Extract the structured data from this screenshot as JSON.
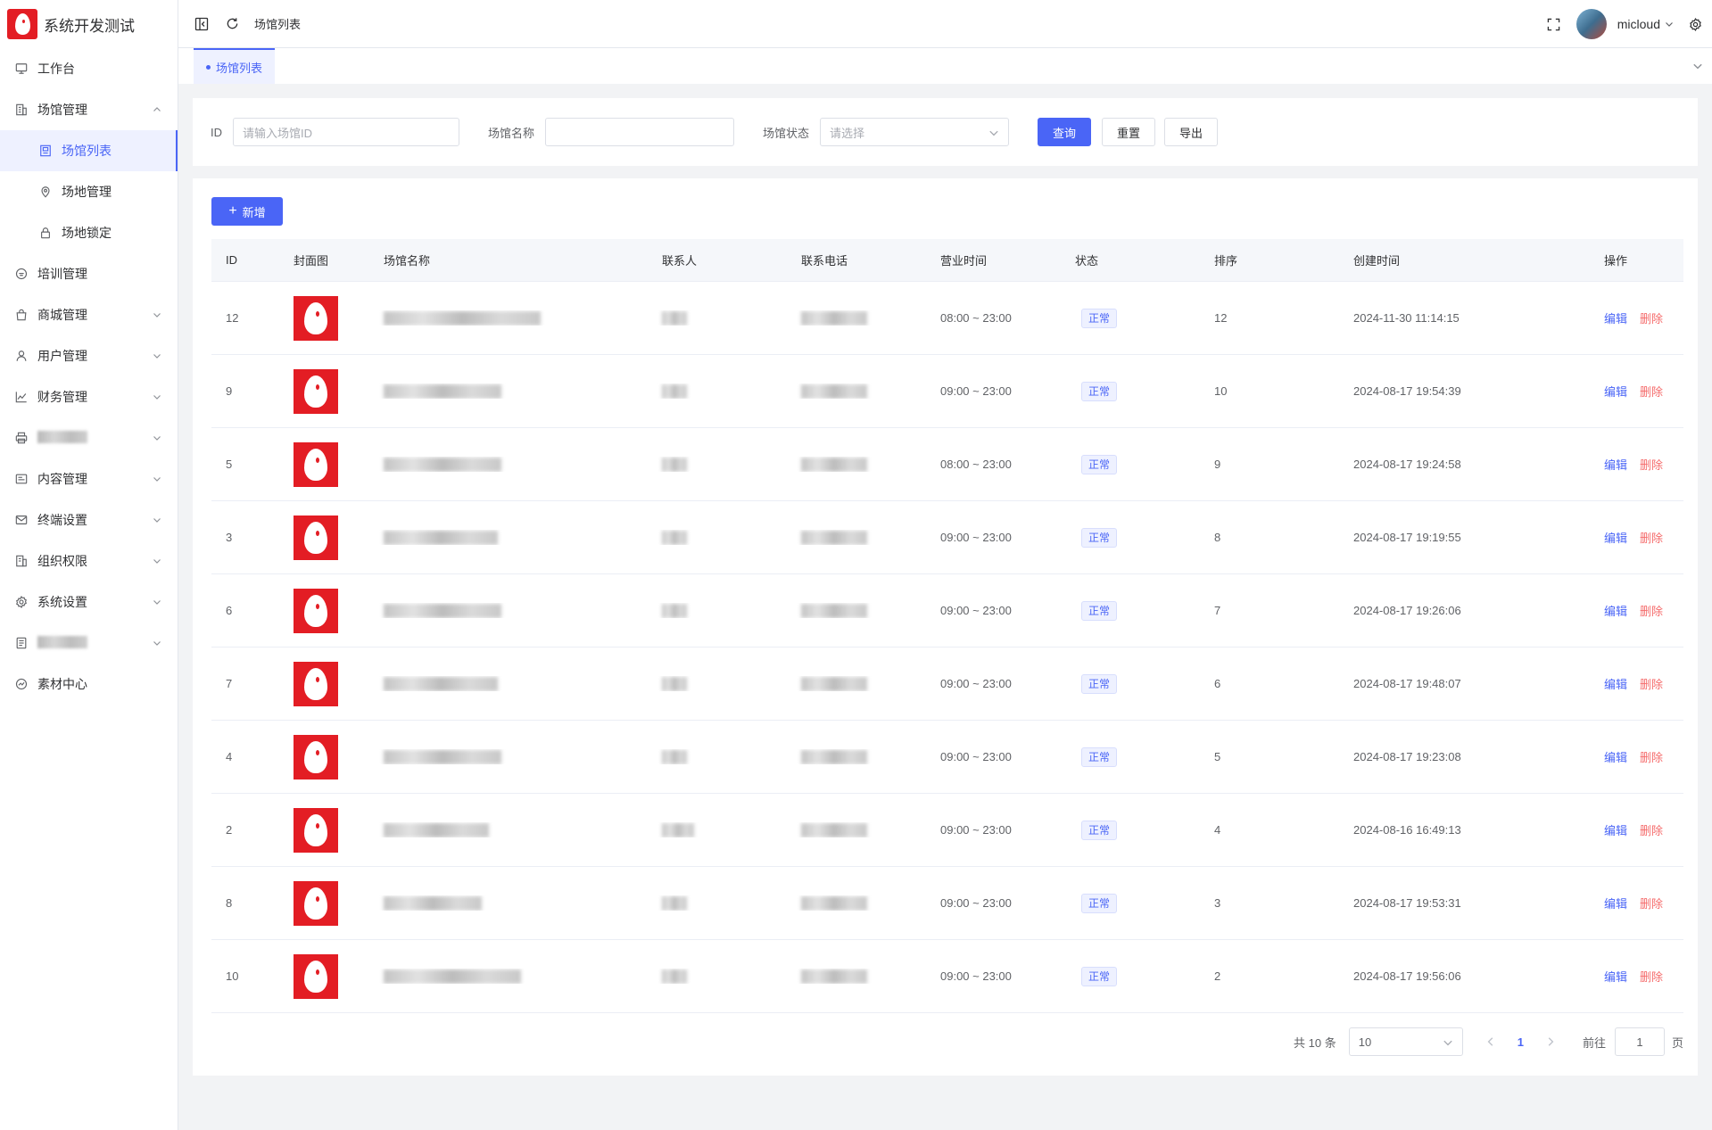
{
  "app": {
    "title": "系统开发测试"
  },
  "sidebar": {
    "items": [
      {
        "label": "工作台",
        "icon": "monitor-icon",
        "expandable": false
      },
      {
        "label": "场馆管理",
        "icon": "building-icon",
        "expandable": true,
        "expanded": true
      },
      {
        "label": "场馆列表",
        "icon": "venue-list-icon",
        "sub": true,
        "active": true
      },
      {
        "label": "场地管理",
        "icon": "location-icon",
        "sub": true
      },
      {
        "label": "场地锁定",
        "icon": "lock-icon",
        "sub": true
      },
      {
        "label": "培训管理",
        "icon": "training-icon",
        "expandable": false
      },
      {
        "label": "商城管理",
        "icon": "shopping-bag-icon",
        "expandable": true
      },
      {
        "label": "用户管理",
        "icon": "user-icon",
        "expandable": true
      },
      {
        "label": "财务管理",
        "icon": "finance-chart-icon",
        "expandable": true
      },
      {
        "label": "",
        "icon": "printer-icon",
        "expandable": true,
        "blurred": true
      },
      {
        "label": "内容管理",
        "icon": "content-icon",
        "expandable": true
      },
      {
        "label": "终端设置",
        "icon": "mail-icon",
        "expandable": true
      },
      {
        "label": "组织权限",
        "icon": "organization-icon",
        "expandable": true
      },
      {
        "label": "系统设置",
        "icon": "gear-icon",
        "expandable": true
      },
      {
        "label": "",
        "icon": "document-icon",
        "expandable": true,
        "blurred": true
      },
      {
        "label": "素材中心",
        "icon": "material-icon",
        "expandable": false
      }
    ]
  },
  "header": {
    "breadcrumb": "场馆列表",
    "username": "micloud"
  },
  "tabs": {
    "active": "场馆列表"
  },
  "search": {
    "id_label": "ID",
    "id_placeholder": "请输入场馆ID",
    "name_label": "场馆名称",
    "name_value": "",
    "status_label": "场馆状态",
    "status_placeholder": "请选择",
    "query_button": "查询",
    "reset_button": "重置",
    "export_button": "导出"
  },
  "table": {
    "add_button": "新增",
    "columns": [
      "ID",
      "封面图",
      "场馆名称",
      "联系人",
      "联系电话",
      "营业时间",
      "状态",
      "排序",
      "创建时间",
      "操作"
    ],
    "edit_label": "编辑",
    "delete_label": "删除",
    "rows": [
      {
        "id": "12",
        "hours": "08:00 ~ 23:00",
        "status": "正常",
        "sort": "12",
        "created": "2024-11-30 11:14:15"
      },
      {
        "id": "9",
        "hours": "09:00 ~ 23:00",
        "status": "正常",
        "sort": "10",
        "created": "2024-08-17 19:54:39"
      },
      {
        "id": "5",
        "hours": "08:00 ~ 23:00",
        "status": "正常",
        "sort": "9",
        "created": "2024-08-17 19:24:58"
      },
      {
        "id": "3",
        "hours": "09:00 ~ 23:00",
        "status": "正常",
        "sort": "8",
        "created": "2024-08-17 19:19:55"
      },
      {
        "id": "6",
        "hours": "09:00 ~ 23:00",
        "status": "正常",
        "sort": "7",
        "created": "2024-08-17 19:26:06"
      },
      {
        "id": "7",
        "hours": "09:00 ~ 23:00",
        "status": "正常",
        "sort": "6",
        "created": "2024-08-17 19:48:07"
      },
      {
        "id": "4",
        "hours": "09:00 ~ 23:00",
        "status": "正常",
        "sort": "5",
        "created": "2024-08-17 19:23:08"
      },
      {
        "id": "2",
        "hours": "09:00 ~ 23:00",
        "status": "正常",
        "sort": "4",
        "created": "2024-08-16 16:49:13"
      },
      {
        "id": "8",
        "hours": "09:00 ~ 23:00",
        "status": "正常",
        "sort": "3",
        "created": "2024-08-17 19:53:31"
      },
      {
        "id": "10",
        "hours": "09:00 ~ 23:00",
        "status": "正常",
        "sort": "2",
        "created": "2024-08-17 19:56:06"
      }
    ]
  },
  "pagination": {
    "total_text": "共 10 条",
    "page_size": "10",
    "current_page": "1",
    "goto_label": "前往",
    "goto_value": "1",
    "page_suffix": "页"
  },
  "colors": {
    "primary": "#4a65f6",
    "danger": "#f56c6c",
    "brand_red": "#e31d24"
  }
}
